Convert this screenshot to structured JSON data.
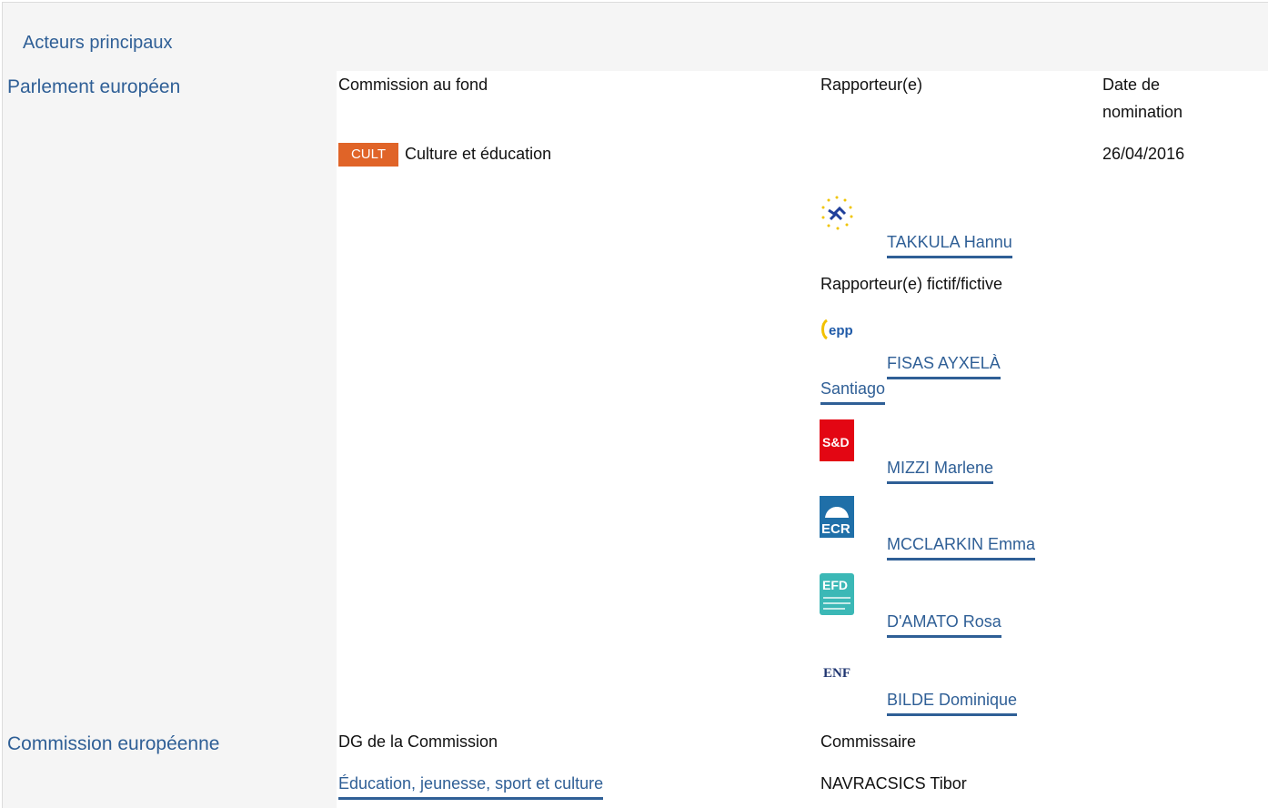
{
  "header": {
    "title": "Acteurs principaux"
  },
  "parliament": {
    "actor_label": "Parlement européen",
    "col_committee_header": "Commission au fond",
    "col_rapporteur_header": "Rapporteur(e)",
    "col_date_header_line1": "Date de",
    "col_date_header_line2": "nomination",
    "committee_badge": "CULT",
    "committee_name": "Culture et éducation",
    "nomination_date": "26/04/2016",
    "rapporteur": {
      "name": "TAKKULA Hannu",
      "group_icon": "alde-logo-icon"
    },
    "shadow_header": "Rapporteur(e) fictif/fictive",
    "shadows": [
      {
        "name_line1": "FISAS AYXELÀ",
        "name_line2": "Santiago",
        "group_icon": "epp-logo-icon",
        "logo_text": "epp"
      },
      {
        "name": "MIZZI Marlene",
        "group_icon": "sd-logo-icon",
        "logo_text": "S&D"
      },
      {
        "name": "MCCLARKIN Emma",
        "group_icon": "ecr-logo-icon",
        "logo_text": "ECR"
      },
      {
        "name": "D'AMATO Rosa",
        "group_icon": "efdd-logo-icon",
        "logo_text": "EFD"
      },
      {
        "name": "BILDE Dominique",
        "group_icon": "enf-logo-icon",
        "logo_text": "ENF"
      }
    ]
  },
  "commission": {
    "actor_label": "Commission européenne",
    "col_dg_header": "DG de la Commission",
    "col_commissioner_header": "Commissaire",
    "dg_name": "Éducation, jeunesse, sport et culture",
    "commissioner": "NAVRACSICS Tibor"
  },
  "colors": {
    "link": "#2f5f96",
    "badge": "#e06428",
    "panel": "#f5f5f5"
  }
}
